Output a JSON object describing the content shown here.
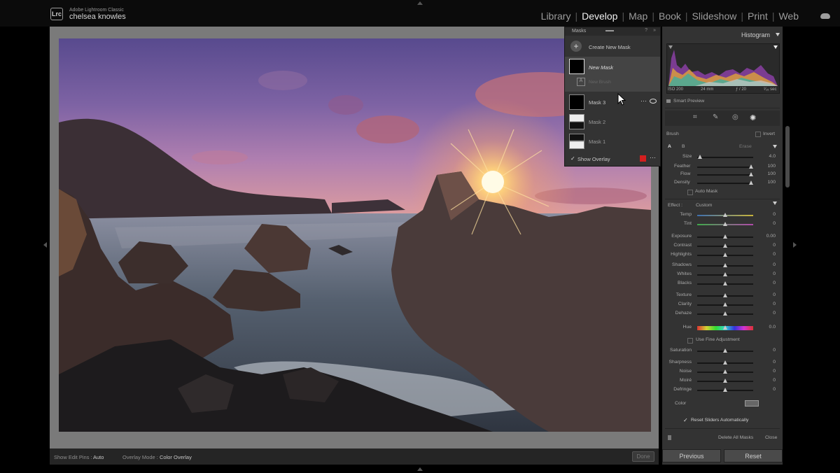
{
  "app": {
    "logo": "Lrc",
    "product": "Adobe Lightroom Classic",
    "user": "chelsea knowles"
  },
  "modules": [
    "Library",
    "Develop",
    "Map",
    "Book",
    "Slideshow",
    "Print",
    "Web"
  ],
  "active_module": "Develop",
  "image_toolbar": {
    "show_edit_pins_label": "Show Edit Pins :",
    "show_edit_pins_value": "Auto",
    "overlay_mode_label": "Overlay Mode :",
    "overlay_mode_value": "Color Overlay",
    "done": "Done"
  },
  "masks_panel": {
    "title": "Masks",
    "create": "Create New Mask",
    "new_mask": "New Mask",
    "new_brush": "New Brush",
    "masks": [
      "Mask 3",
      "Mask 2",
      "Mask 1"
    ],
    "show_overlay": "Show Overlay",
    "overlay_color": "#d31f1f"
  },
  "histogram": {
    "title": "Histogram",
    "iso": "ISO 200",
    "focal": "24 mm",
    "aperture": "ƒ / 20",
    "shutter": "¹⁄₁₅ sec",
    "smart_preview": "Smart Preview"
  },
  "brush": {
    "title": "Brush",
    "invert": "Invert",
    "tab_a": "A",
    "tab_b": "B",
    "erase": "Erase",
    "size_label": "Size",
    "size": "4.0",
    "feather_label": "Feather",
    "feather": "100",
    "flow_label": "Flow",
    "flow": "100",
    "density_label": "Density",
    "density": "100",
    "auto_mask": "Auto Mask"
  },
  "effect": {
    "label": "Effect :",
    "preset": "Custom",
    "sliders": [
      {
        "label": "Temp",
        "value": "0"
      },
      {
        "label": "Tint",
        "value": "0"
      },
      {
        "label": "Exposure",
        "value": "0.00"
      },
      {
        "label": "Contrast",
        "value": "0"
      },
      {
        "label": "Highlights",
        "value": "0"
      },
      {
        "label": "Shadows",
        "value": "0"
      },
      {
        "label": "Whites",
        "value": "0"
      },
      {
        "label": "Blacks",
        "value": "0"
      },
      {
        "label": "Texture",
        "value": "0"
      },
      {
        "label": "Clarity",
        "value": "0"
      },
      {
        "label": "Dehaze",
        "value": "0"
      },
      {
        "label": "Hue",
        "value": "0.0"
      },
      {
        "label": "Saturation",
        "value": "0"
      },
      {
        "label": "Sharpness",
        "value": "0"
      },
      {
        "label": "Noise",
        "value": "0"
      },
      {
        "label": "Moiré",
        "value": "0"
      },
      {
        "label": "Defringe",
        "value": "0"
      }
    ],
    "use_fine": "Use Fine Adjustment",
    "color_label": "Color",
    "reset_sliders": "Reset Sliders Automatically",
    "delete_all": "Delete All Masks",
    "close": "Close"
  },
  "buttons": {
    "previous": "Previous",
    "reset": "Reset"
  },
  "colors": {
    "panel_bg": "#333333",
    "canvas_bg": "#7a7a7a",
    "active_text": "#f1f1f1"
  }
}
